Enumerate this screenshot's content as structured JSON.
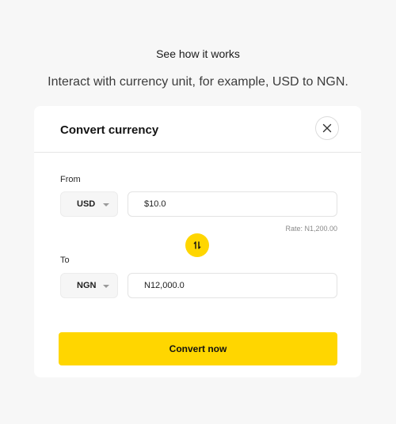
{
  "hero": {
    "eyebrow": "See how it works",
    "intro": "Interact with currency unit, for example, USD to NGN."
  },
  "converter": {
    "title": "Convert currency",
    "close_icon": "close-icon",
    "from": {
      "label": "From",
      "currency": "USD",
      "amount": "$10.0"
    },
    "rate": "Rate: N1,200.00",
    "swap_icon": "swap-arrows-icon",
    "to": {
      "label": "To",
      "currency": "NGN",
      "amount": "N12,000.0"
    },
    "convert_label": "Convert now"
  },
  "colors": {
    "background": "#f7f7f7",
    "card": "#ffffff",
    "accent": "#ffd600"
  }
}
